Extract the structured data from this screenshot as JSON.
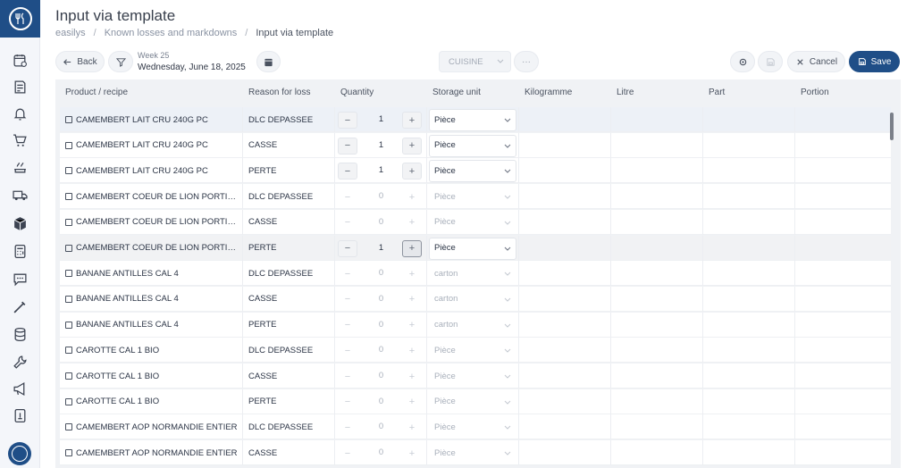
{
  "app": {
    "title": "Input via template",
    "breadcrumb": [
      "easilys",
      "Known losses and markdowns",
      "Input via template"
    ]
  },
  "sidebar": {
    "items": [
      "calendar-check-icon",
      "invoice-icon",
      "bell-icon",
      "cart-icon",
      "cooking-icon",
      "truck-icon",
      "box-icon",
      "calculator-icon",
      "chat-icon",
      "thermometer-icon",
      "database-icon",
      "wrench-icon",
      "megaphone-icon",
      "document-icon"
    ]
  },
  "toolbar": {
    "back_label": "Back",
    "week_label": "Week 25",
    "date_label": "Wednesday, June 18, 2025",
    "cuisine_select": "CUISINE",
    "more_label": "···",
    "cancel_label": "Cancel",
    "save_label": "Save"
  },
  "table": {
    "columns": [
      "Product / recipe",
      "Reason for loss",
      "Quantity",
      "Storage unit",
      "Kilogramme",
      "Litre",
      "Part",
      "Portion"
    ],
    "rows": [
      {
        "product": "CAMEMBERT LAIT CRU 240G PC",
        "reason": "DLC DEPASSEE",
        "qty": "1",
        "unit": "Pièce",
        "active": true
      },
      {
        "product": "CAMEMBERT LAIT CRU 240G PC",
        "reason": "CASSE",
        "qty": "1",
        "unit": "Pièce",
        "active": true
      },
      {
        "product": "CAMEMBERT LAIT CRU 240G PC",
        "reason": "PERTE",
        "qty": "1",
        "unit": "Pièce",
        "active": true
      },
      {
        "product": "CAMEMBERT COEUR DE LION PORTIONS",
        "reason": "DLC DEPASSEE",
        "qty": "0",
        "unit": "Pièce",
        "active": false
      },
      {
        "product": "CAMEMBERT COEUR DE LION PORTIONS",
        "reason": "CASSE",
        "qty": "0",
        "unit": "Pièce",
        "active": false
      },
      {
        "product": "CAMEMBERT COEUR DE LION PORTIONS",
        "reason": "PERTE",
        "qty": "1",
        "unit": "Pièce",
        "active": true
      },
      {
        "product": "BANANE ANTILLES CAL 4",
        "reason": "DLC DEPASSEE",
        "qty": "0",
        "unit": "carton",
        "active": false
      },
      {
        "product": "BANANE ANTILLES CAL 4",
        "reason": "CASSE",
        "qty": "0",
        "unit": "carton",
        "active": false
      },
      {
        "product": "BANANE ANTILLES CAL 4",
        "reason": "PERTE",
        "qty": "0",
        "unit": "carton",
        "active": false
      },
      {
        "product": "CAROTTE CAL 1 BIO",
        "reason": "DLC DEPASSEE",
        "qty": "0",
        "unit": "Pièce",
        "active": false
      },
      {
        "product": "CAROTTE CAL 1 BIO",
        "reason": "CASSE",
        "qty": "0",
        "unit": "Pièce",
        "active": false
      },
      {
        "product": "CAROTTE CAL 1 BIO",
        "reason": "PERTE",
        "qty": "0",
        "unit": "Pièce",
        "active": false
      },
      {
        "product": "CAMEMBERT AOP NORMANDIE ENTIER",
        "reason": "DLC DEPASSEE",
        "qty": "0",
        "unit": "Pièce",
        "active": false
      },
      {
        "product": "CAMEMBERT AOP NORMANDIE ENTIER",
        "reason": "CASSE",
        "qty": "0",
        "unit": "Pièce",
        "active": false
      }
    ],
    "minus_glyph": "−",
    "plus_glyph": "+"
  },
  "colors": {
    "brand": "#1f4e87",
    "row_highlight": "#edf1f7"
  }
}
